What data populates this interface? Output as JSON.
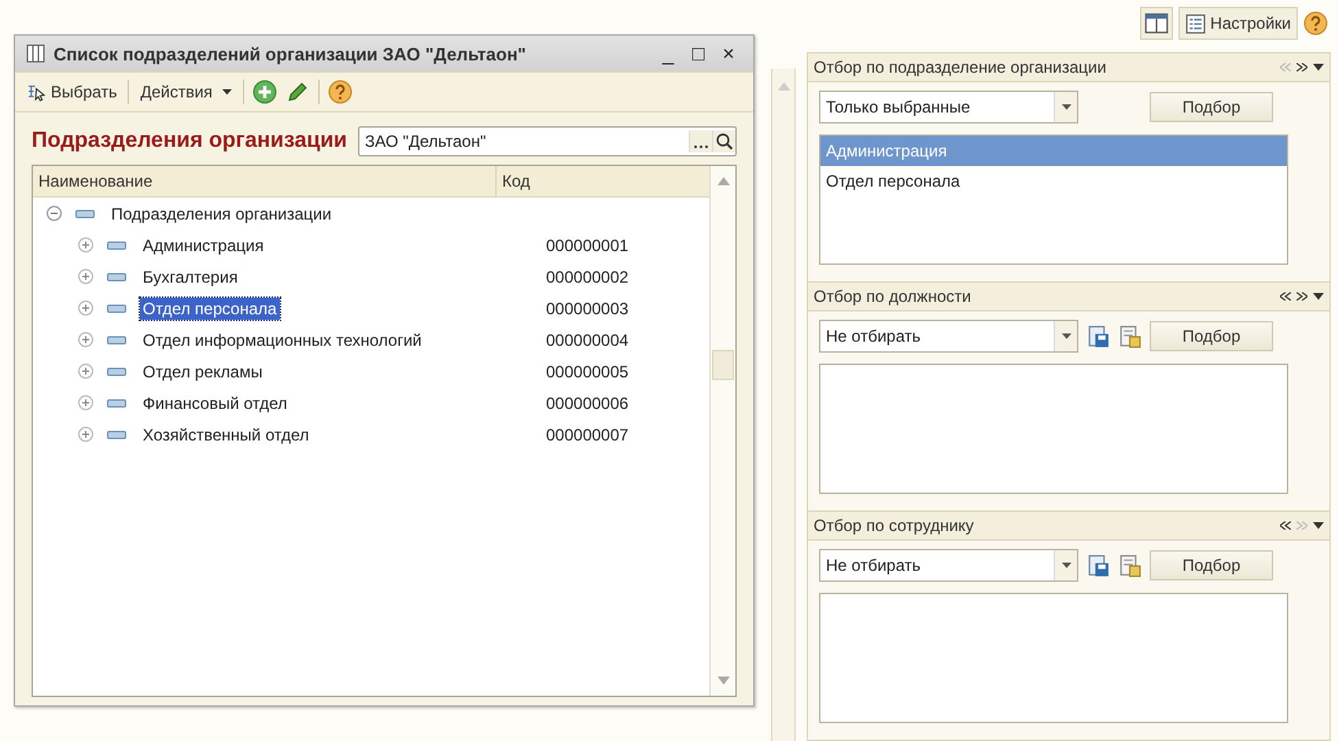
{
  "window": {
    "title": "Список подразделений организации ЗАО \"Дельтаон\"",
    "controls": [
      "_",
      "□",
      "×"
    ]
  },
  "toolbar": {
    "select_label": "Выбрать",
    "actions_label": "Действия"
  },
  "header": {
    "title": "Подразделения организации",
    "organization": "ЗАО \"Дельтаон\""
  },
  "table": {
    "columns": [
      "Наименование",
      "Код"
    ],
    "root": {
      "name": "Подразделения организации",
      "expanded": true,
      "children": [
        {
          "name": "Администрация",
          "code": "000000001",
          "expanded": false,
          "selected": false
        },
        {
          "name": "Бухгалтерия",
          "code": "000000002",
          "expanded": false,
          "selected": false
        },
        {
          "name": "Отдел персонала",
          "code": "000000003",
          "expanded": false,
          "selected": true
        },
        {
          "name": "Отдел информационных технологий",
          "code": "000000004",
          "expanded": false,
          "selected": false
        },
        {
          "name": "Отдел рекламы",
          "code": "000000005",
          "expanded": false,
          "selected": false
        },
        {
          "name": "Финансовый отдел",
          "code": "000000006",
          "expanded": false,
          "selected": false
        },
        {
          "name": "Хозяйственный отдел",
          "code": "000000007",
          "expanded": false,
          "selected": false
        }
      ]
    }
  },
  "top_toolbar": {
    "settings_label": "Настройки"
  },
  "filters": [
    {
      "title": "Отбор по подразделение организации",
      "prev_enabled": false,
      "next_enabled": true,
      "mode": "Только выбранные",
      "save_icons": false,
      "pick_label": "Подбор",
      "items": [
        {
          "label": "Администрация",
          "selected": true
        },
        {
          "label": "Отдел персонала",
          "selected": false
        }
      ]
    },
    {
      "title": "Отбор по должности",
      "prev_enabled": true,
      "next_enabled": true,
      "mode": "Не отбирать",
      "save_icons": true,
      "pick_label": "Подбор"
    },
    {
      "title": "Отбор по сотруднику",
      "prev_enabled": true,
      "next_enabled": false,
      "mode": "Не отбирать",
      "save_icons": true,
      "pick_label": "Подбор"
    }
  ]
}
